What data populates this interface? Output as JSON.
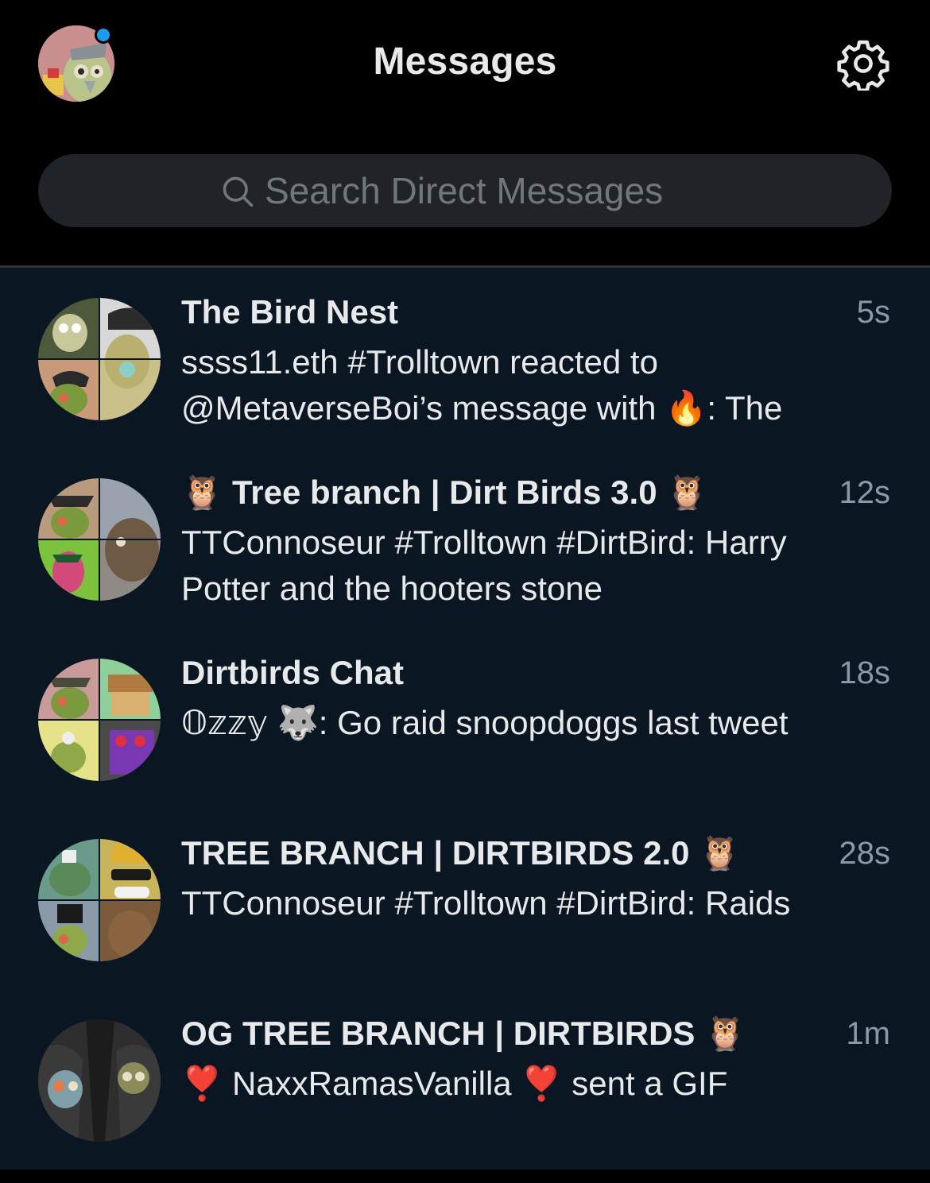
{
  "header": {
    "title": "Messages",
    "accent_color": "#1d9bf0",
    "settings_icon": "gear-icon"
  },
  "search": {
    "placeholder": "Search Direct Messages",
    "icon": "search-icon"
  },
  "conversations": [
    {
      "name": "The Bird Nest",
      "time": "5s",
      "preview": "ssss11.eth #Trolltown reacted to @MetaverseBoi’s message with 🔥: The"
    },
    {
      "name": "🦉 Tree branch |  Dirt Birds 3.0 🦉",
      "time": "12s",
      "preview": "TTConnoseur #Trolltown #DirtBird: Harry Potter and the hooters stone"
    },
    {
      "name": "Dirtbirds Chat",
      "time": "18s",
      "preview": "𝕆𝕫𝕫𝕪 🐺: Go raid snoopdoggs last tweet"
    },
    {
      "name": "TREE BRANCH | DIRTBIRDS 2.0 🦉",
      "time": "28s",
      "preview": "TTConnoseur #Trolltown #DirtBird: Raids"
    },
    {
      "name": "OG TREE BRANCH | DIRTBIRDS 🦉",
      "time": "1m",
      "preview": "❣️ NaxxRamasVanilla ❣️  sent a GIF"
    }
  ]
}
